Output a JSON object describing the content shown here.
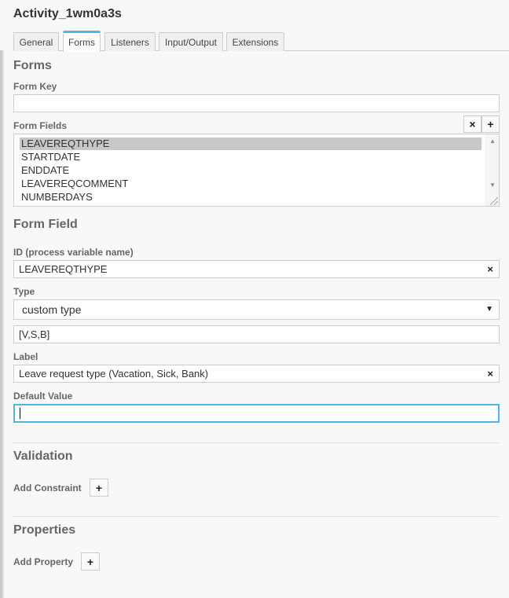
{
  "header": {
    "title": "Activity_1wm0a3s"
  },
  "tabs": [
    {
      "label": "General"
    },
    {
      "label": "Forms"
    },
    {
      "label": "Listeners"
    },
    {
      "label": "Input/Output"
    },
    {
      "label": "Extensions"
    }
  ],
  "forms": {
    "title": "Forms",
    "form_key_label": "Form Key",
    "form_key_value": "",
    "form_fields_label": "Form Fields",
    "remove_label": "×",
    "add_label": "+",
    "fields": [
      {
        "label": "LEAVEREQTHYPE"
      },
      {
        "label": "STARTDATE"
      },
      {
        "label": "ENDDATE"
      },
      {
        "label": "LEAVEREQCOMMENT"
      },
      {
        "label": "NUMBERDAYS"
      }
    ],
    "selected_field": "LEAVEREQTHYPE"
  },
  "form_field": {
    "title": "Form Field",
    "id_label": "ID (process variable name)",
    "id_value": "LEAVEREQTHYPE",
    "type_label": "Type",
    "type_value": "custom type",
    "custom_type_value": "[V,S,B]",
    "label_label": "Label",
    "label_value": "Leave request type (Vacation, Sick, Bank)",
    "default_label": "Default Value",
    "default_value": "",
    "clear_label": "×"
  },
  "validation": {
    "title": "Validation",
    "add_constraint_label": "Add Constraint",
    "add_label": "+"
  },
  "properties": {
    "title": "Properties",
    "add_property_label": "Add Property",
    "add_label": "+"
  },
  "icons": {
    "scroll_up": "▲",
    "scroll_down": "▼",
    "dropdown": "▼"
  }
}
